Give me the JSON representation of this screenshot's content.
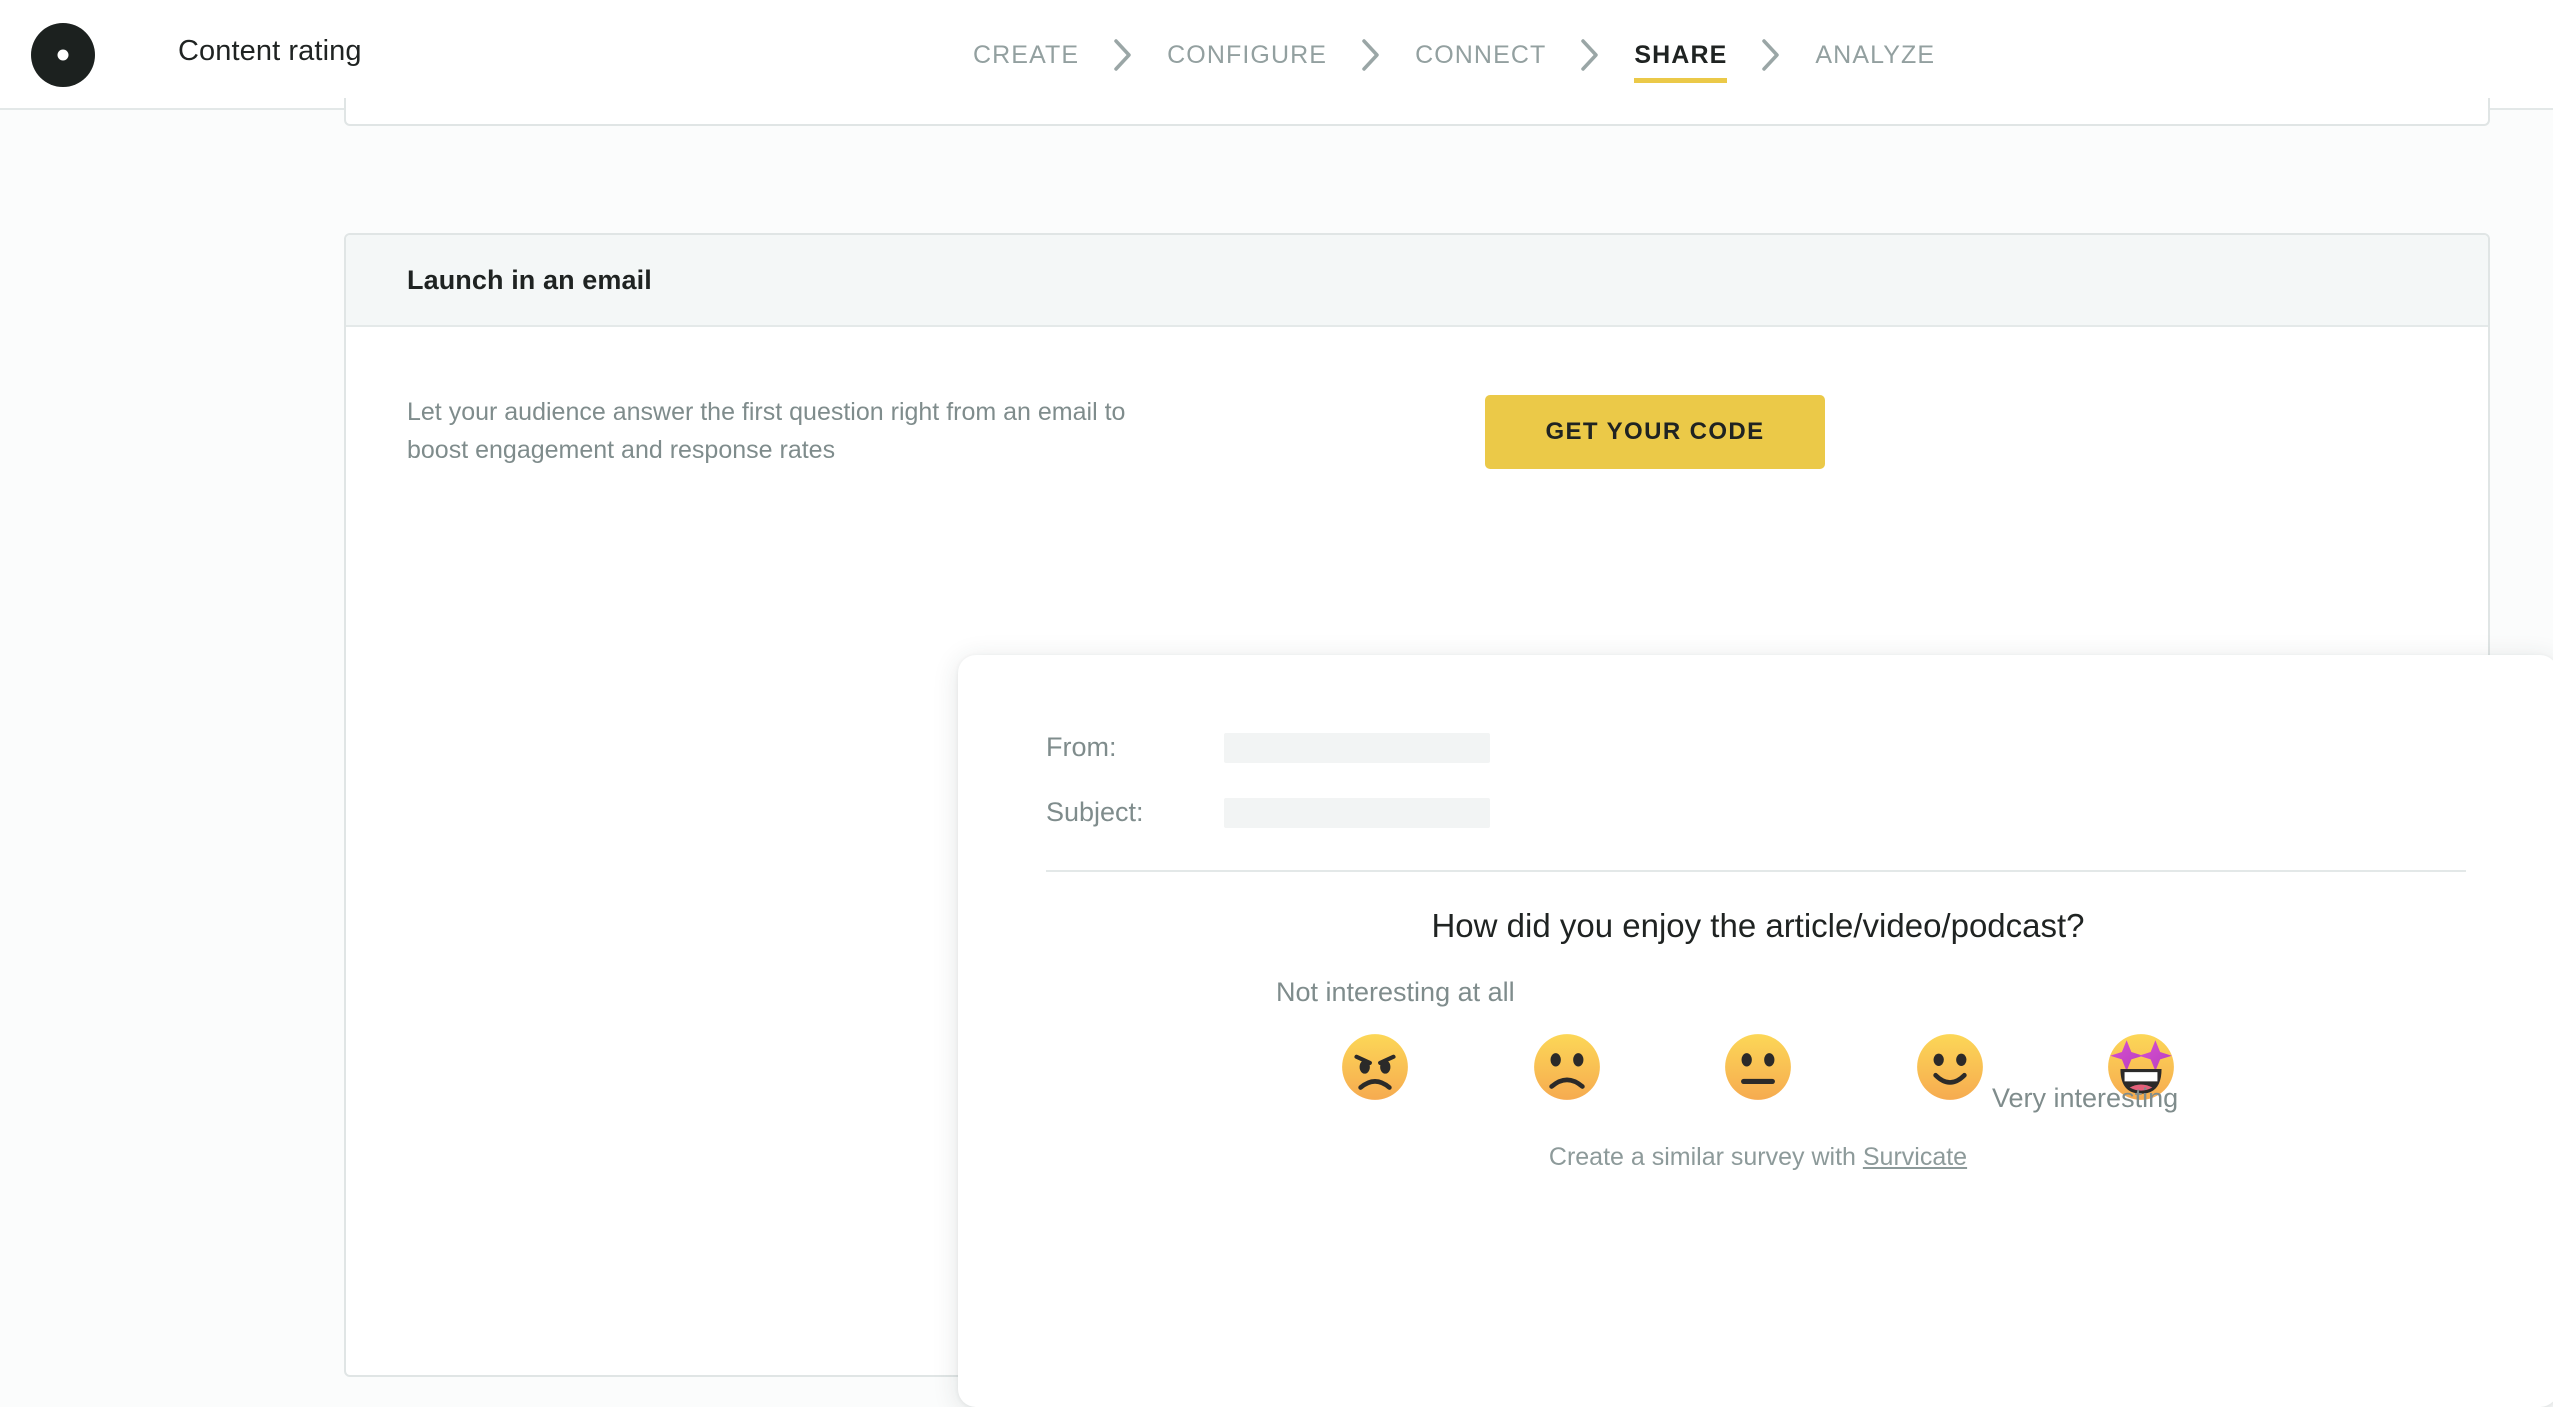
{
  "header": {
    "logo_icon": "survicate-pinwheel-logo",
    "app_title": "Content rating",
    "steps": [
      {
        "label": "CREATE",
        "active": false
      },
      {
        "label": "CONFIGURE",
        "active": false
      },
      {
        "label": "CONNECT",
        "active": false
      },
      {
        "label": "SHARE",
        "active": true
      },
      {
        "label": "ANALYZE",
        "active": false
      }
    ],
    "separator_icon": "chevron-right-icon",
    "active_underline_color": "#ebc948"
  },
  "card": {
    "title": "Launch in an email",
    "blurb": "Let your audience answer the first question right from an email to boost engagement and response rates",
    "cta_label": "GET YOUR CODE",
    "cta_color": "#ebc948"
  },
  "email_preview": {
    "from_label": "From:",
    "from_value": "",
    "subject_label": "Subject:",
    "subject_value": "",
    "question": "How did you enjoy the article/video/podcast?",
    "scale_low_label": "Not interesting at all",
    "scale_high_label": "Very interesting",
    "faces": [
      {
        "name": "angry-face-emoji",
        "value": 1
      },
      {
        "name": "frowning-face-emoji",
        "value": 2
      },
      {
        "name": "neutral-face-emoji",
        "value": 3
      },
      {
        "name": "slightly-smiling-emoji",
        "value": 4
      },
      {
        "name": "star-struck-face-emoji",
        "value": 5
      }
    ],
    "footer_prefix": "Create a similar survey with ",
    "footer_brand": "Survicate"
  }
}
